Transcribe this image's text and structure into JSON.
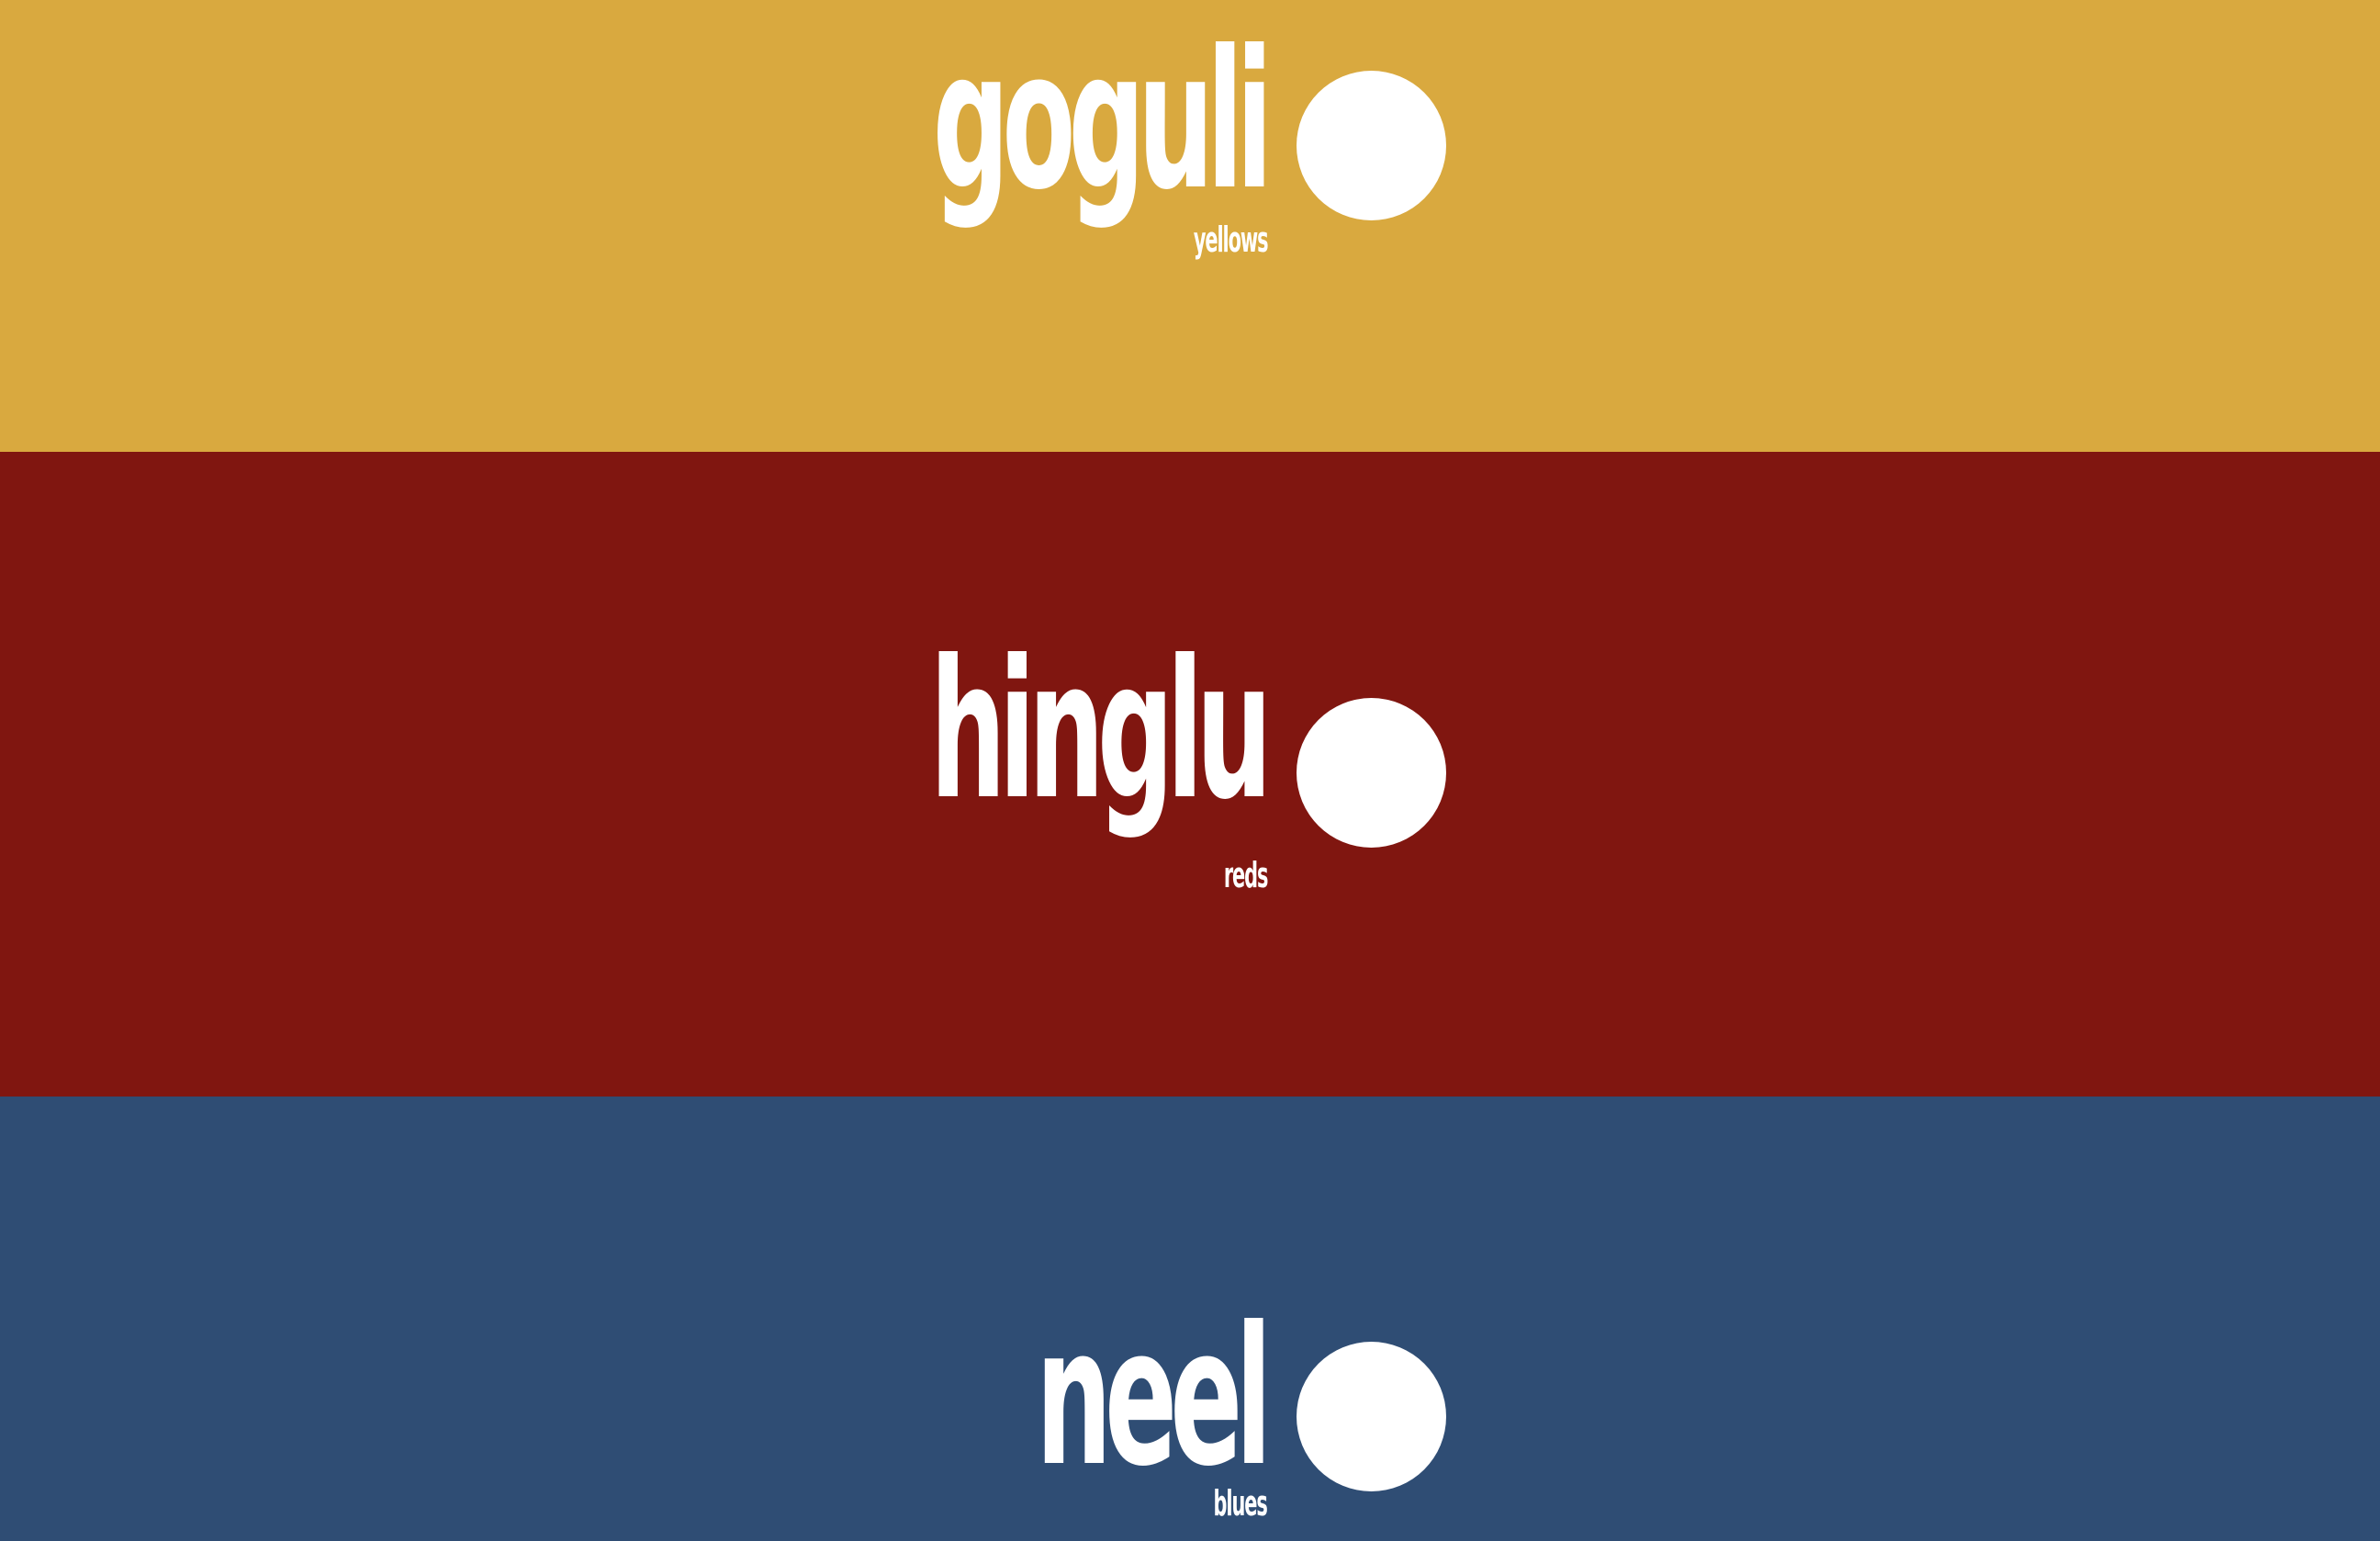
{
  "swatches": [
    {
      "title": "goguli",
      "subtitle": "yellows",
      "background_color": "#d9a93f",
      "text_color": "#ffffff"
    },
    {
      "title": "hinglu",
      "subtitle": "reds",
      "background_color": "#801610",
      "text_color": "#ffffff"
    },
    {
      "title": "neel",
      "subtitle": "blues",
      "background_color": "#2f4d74",
      "text_color": "#ffffff"
    }
  ]
}
